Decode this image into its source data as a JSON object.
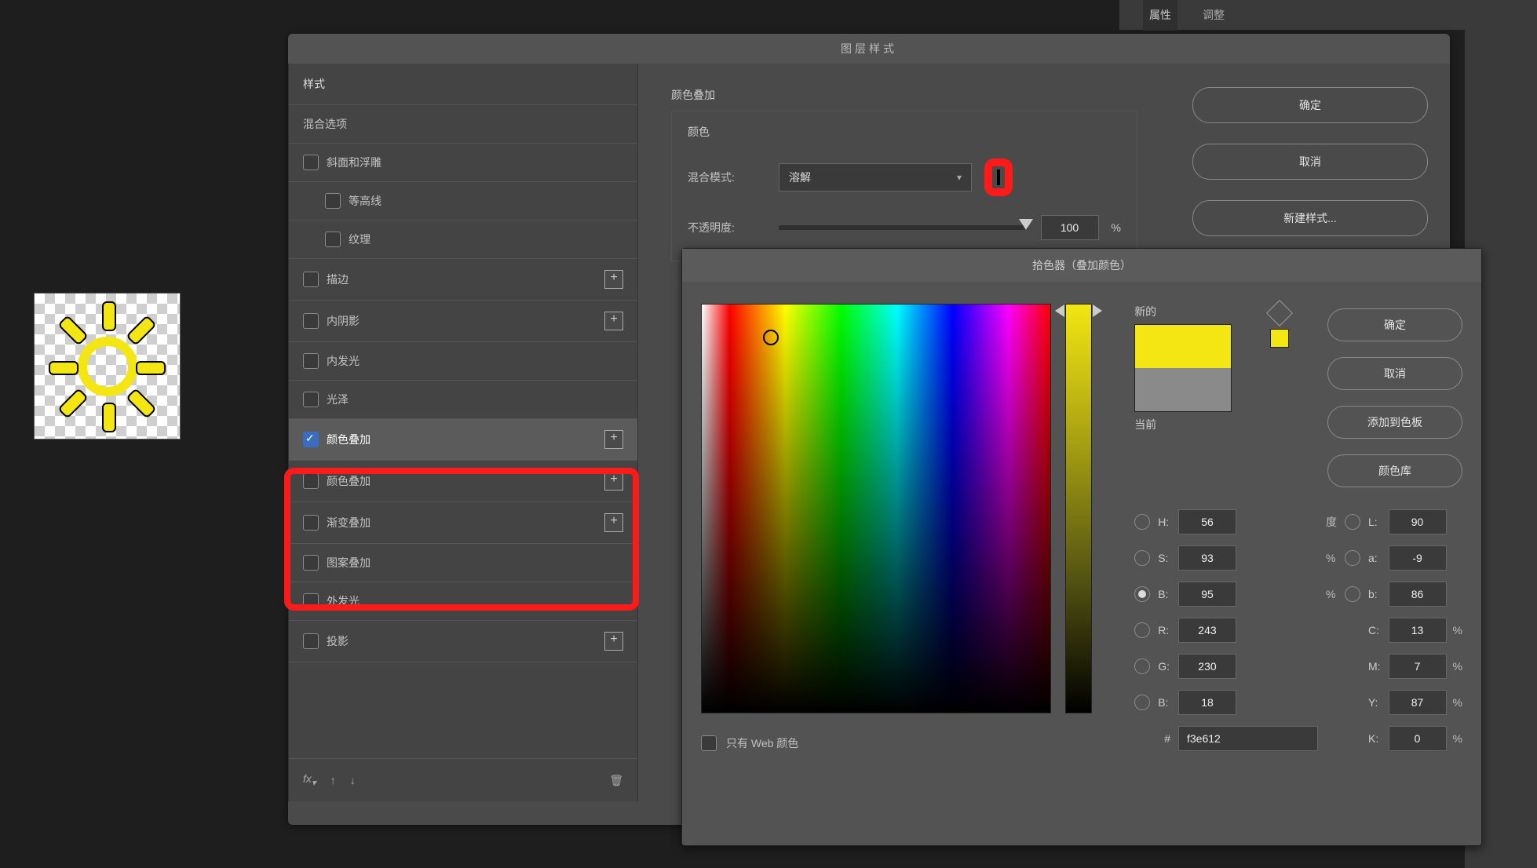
{
  "right_panel": {
    "tabs": [
      "属性",
      "调整"
    ]
  },
  "layer_style": {
    "title": "图层样式",
    "sections": {
      "styles_header": "样式",
      "blend_options": "混合选项"
    },
    "effects": {
      "bevel": "斜面和浮雕",
      "contour": "等高线",
      "texture": "纹理",
      "stroke": "描边",
      "inner_shadow": "内阴影",
      "inner_glow": "内发光",
      "satin": "光泽",
      "color_overlay_1": "颜色叠加",
      "color_overlay_2": "颜色叠加",
      "gradient_overlay": "渐变叠加",
      "pattern_overlay": "图案叠加",
      "outer_glow": "外发光",
      "drop_shadow": "投影"
    },
    "footer": {
      "fx": "fx"
    },
    "content": {
      "section": "颜色叠加",
      "color_label": "颜色",
      "blend_mode_label": "混合模式:",
      "blend_mode_value": "溶解",
      "opacity_label": "不透明度:",
      "opacity_value": "100",
      "opacity_unit": "%"
    },
    "actions": {
      "ok": "确定",
      "cancel": "取消",
      "new_style": "新建样式..."
    },
    "swatch_color": "#f3e612"
  },
  "color_picker": {
    "title": "拾色器（叠加颜色）",
    "actions": {
      "ok": "确定",
      "cancel": "取消",
      "add_swatch": "添加到色板",
      "libraries": "颜色库"
    },
    "preview": {
      "new_label": "新的",
      "current_label": "当前"
    },
    "web_only_label": "只有 Web 颜色",
    "fields": {
      "H": {
        "label": "H:",
        "value": "56",
        "unit": "度"
      },
      "S": {
        "label": "S:",
        "value": "93",
        "unit": "%"
      },
      "Bv": {
        "label": "B:",
        "value": "95",
        "unit": "%"
      },
      "L": {
        "label": "L:",
        "value": "90"
      },
      "a": {
        "label": "a:",
        "value": "-9"
      },
      "b": {
        "label": "b:",
        "value": "86"
      },
      "R": {
        "label": "R:",
        "value": "243"
      },
      "G": {
        "label": "G:",
        "value": "230"
      },
      "Bc": {
        "label": "B:",
        "value": "18"
      },
      "C": {
        "label": "C:",
        "value": "13",
        "unit": "%"
      },
      "M": {
        "label": "M:",
        "value": "7",
        "unit": "%"
      },
      "Y": {
        "label": "Y:",
        "value": "87",
        "unit": "%"
      },
      "K": {
        "label": "K:",
        "value": "0",
        "unit": "%"
      },
      "hex_prefix": "#",
      "hex": "f3e612"
    }
  }
}
